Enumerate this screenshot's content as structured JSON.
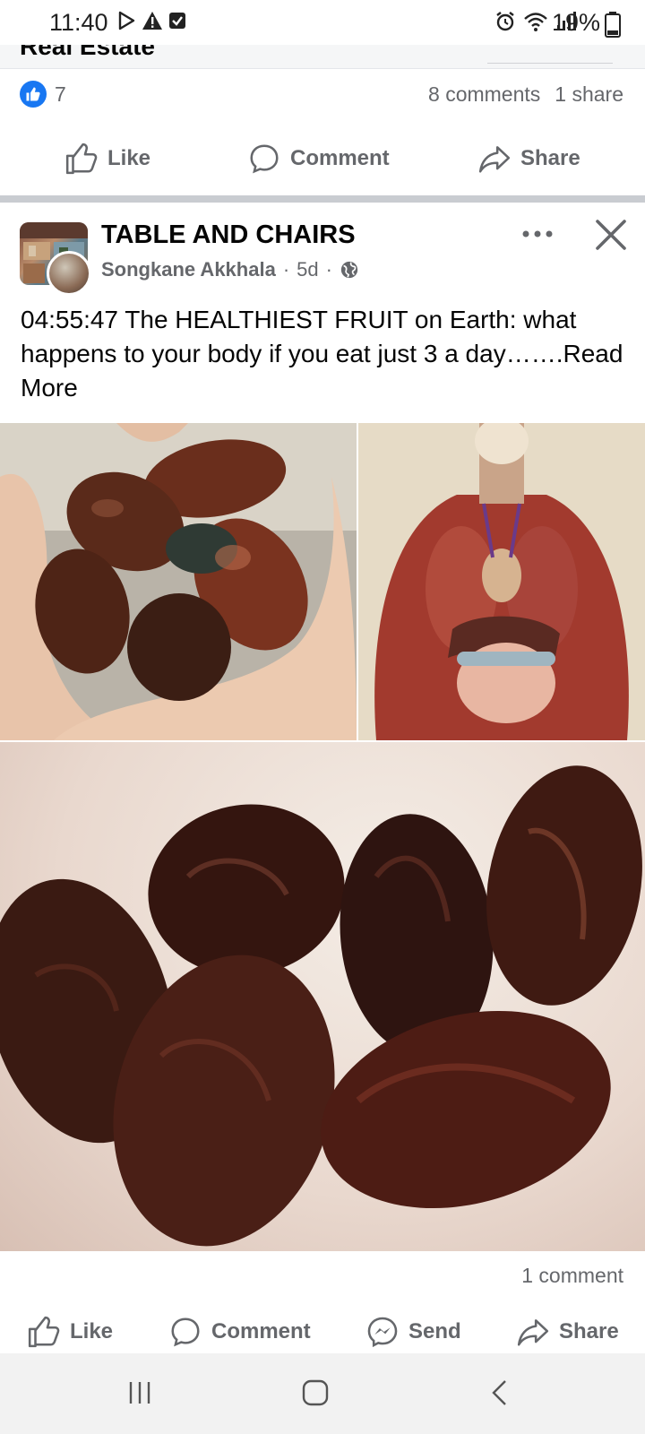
{
  "status_bar": {
    "time": "11:40",
    "battery": "19%",
    "left_icons": [
      "play-store-icon",
      "warning-icon",
      "checkbox-icon"
    ],
    "right_icons": [
      "alarm-icon",
      "wifi-icon",
      "signal-icon",
      "battery-icon"
    ]
  },
  "prev_post": {
    "title_fragment": "Real Estate",
    "like_count": "7",
    "comments": "8 comments",
    "shares": "1 share",
    "actions": {
      "like": "Like",
      "comment": "Comment",
      "share": "Share"
    }
  },
  "post": {
    "page_name": "TABLE AND CHAIRS",
    "author": "Songkane Akkhala",
    "time": "5d",
    "separator": "·",
    "privacy_icon": "globe-icon",
    "text": "04:55:47  The HEALTHIEST FRUIT on Earth: what happens to your body if you eat just 3 a day…….",
    "read_more": "Read More",
    "comments": "1 comment",
    "actions": {
      "like": "Like",
      "comment": "Comment",
      "send": "Send",
      "share": "Share"
    }
  },
  "colors": {
    "brand_blue": "#1877f2",
    "secondary_text": "#65676b",
    "primary_text": "#050505",
    "separator": "#c9ccd1"
  }
}
